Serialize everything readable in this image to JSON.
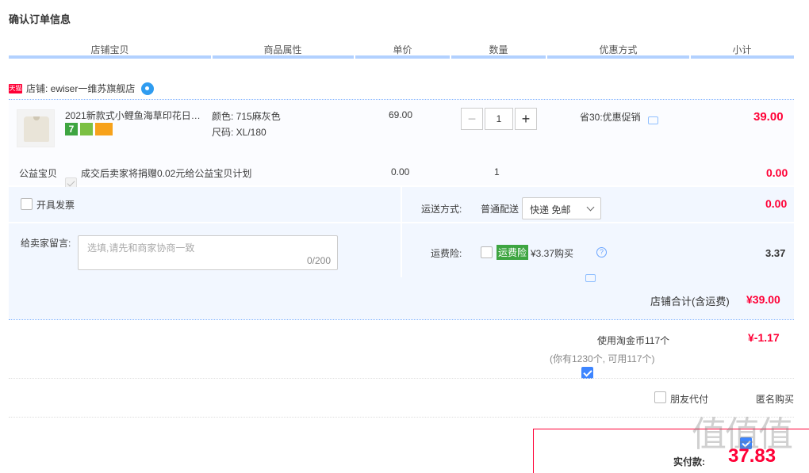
{
  "page_title": "确认订单信息",
  "columns": [
    "店铺宝贝",
    "商品属性",
    "单价",
    "数量",
    "优惠方式",
    "小计"
  ],
  "shop": {
    "tmall_badge": "天猫",
    "label": "店铺: ewiser一维苏旗舰店"
  },
  "item": {
    "name": "2021新款式小鲤鱼海草印花日…",
    "color": "颜色: 715麻灰色",
    "size": "尺码: XL/180",
    "unit_price": "69.00",
    "quantity": "1",
    "minus": "−",
    "plus": "+",
    "discount": "省30:优惠促销",
    "subtotal": "39.00"
  },
  "charity": {
    "label": "公益宝贝",
    "text": "成交后卖家将捐赠0.02元给公益宝贝计划",
    "price": "0.00",
    "qty": "1",
    "subtotal": "0.00"
  },
  "invoice": {
    "label": "开具发票"
  },
  "message": {
    "label": "给卖家留言:",
    "placeholder": "选填,请先和商家协商一致",
    "counter": "0/200"
  },
  "shipping": {
    "label": "运送方式:",
    "type": "普通配送",
    "selected": "快递 免邮",
    "price": "0.00"
  },
  "insurance": {
    "label": "运费险:",
    "tag": "运费险",
    "text": "¥3.37购买",
    "price": "3.37"
  },
  "shop_total": {
    "label": "店铺合计(含运费)",
    "value": "¥39.00"
  },
  "taojinbi": {
    "label": "使用淘金币117个",
    "value": "¥-1.17",
    "note": "(你有1230个, 可用117个)"
  },
  "options": {
    "friend_pay": "朋友代付",
    "anonymous": "匿名购买"
  },
  "final": {
    "label": "实付款:",
    "value": "37.83"
  },
  "watermark": "值值值",
  "colors": {
    "accent_red": "#ff0036",
    "accent_blue": "#3d85ff",
    "header_line": "#b2d1ff"
  }
}
